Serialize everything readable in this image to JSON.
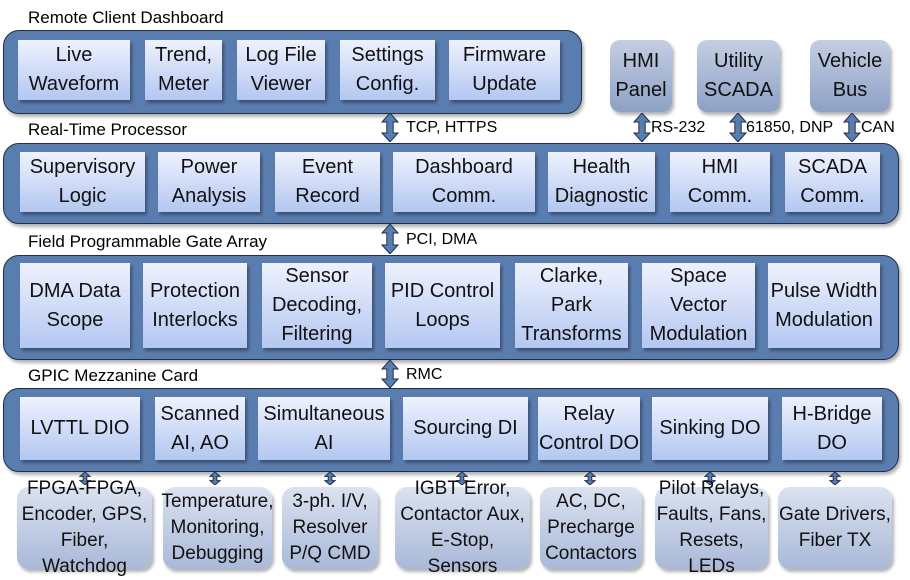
{
  "layers": [
    {
      "title": "Remote Client Dashboard",
      "blocks": [
        "Live\nWaveform",
        "Trend,\nMeter",
        "Log File\nViewer",
        "Settings\nConfig.",
        "Firmware\nUpdate"
      ]
    },
    {
      "title": "Real-Time Processor",
      "blocks": [
        "Supervisory\nLogic",
        "Power\nAnalysis",
        "Event\nRecord",
        "Dashboard\nComm.",
        "Health\nDiagnostic",
        "HMI\nComm.",
        "SCADA\nComm."
      ]
    },
    {
      "title": "Field Programmable Gate Array",
      "blocks": [
        "DMA Data\nScope",
        "Protection\nInterlocks",
        "Sensor\nDecoding,\nFiltering",
        "PID Control\nLoops",
        "Clarke,\nPark\nTransforms",
        "Space\nVector\nModulation",
        "Pulse Width\nModulation"
      ]
    },
    {
      "title": "GPIC Mezzanine Card",
      "blocks": [
        "LVTTL DIO",
        "Scanned\nAI, AO",
        "Simultaneous\nAI",
        "Sourcing DI",
        "Relay\nControl DO",
        "Sinking DO",
        "H-Bridge\nDO"
      ]
    }
  ],
  "external_top": [
    "HMI\nPanel",
    "Utility\nSCADA",
    "Vehicle\nBus"
  ],
  "links": {
    "dashboard": "TCP, HTTPS",
    "hmi": "RS-232",
    "scada": "61850, DNP",
    "vehicle": "CAN",
    "fpga": "PCI, DMA",
    "gpic": "RMC"
  },
  "io": [
    "FPGA-FPGA,\nEncoder, GPS,\nFiber, Watchdog",
    "Temperature,\nMonitoring,\nDebugging",
    "3-ph. I/V,\nResolver\nP/Q CMD",
    "IGBT Error,\nContactor Aux,\nE-Stop, Sensors",
    "AC, DC,\nPrecharge\nContactors",
    "Pilot Relays,\nFaults, Fans,\nResets, LEDs",
    "Gate Drivers,\nFiber TX"
  ],
  "colors": {
    "band": "#5a7db0",
    "block_top": "#eef2fd",
    "block_bottom": "#b3c7f1",
    "arrow": "#5a7db0"
  }
}
